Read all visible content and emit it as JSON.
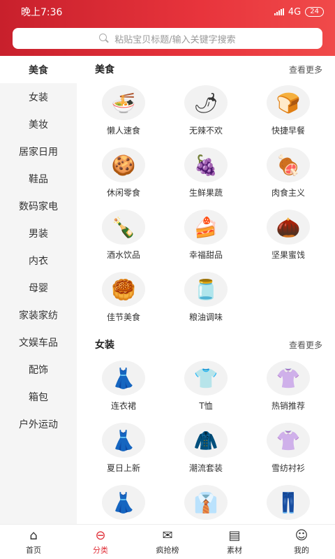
{
  "status": {
    "time": "晚上7:36",
    "network": "4G",
    "battery": "24"
  },
  "search": {
    "placeholder": "粘贴宝贝标题/输入关键字搜索"
  },
  "sidebar": {
    "items": [
      "美食",
      "女装",
      "美妆",
      "居家日用",
      "鞋品",
      "数码家电",
      "男装",
      "内衣",
      "母婴",
      "家装家纺",
      "文娱车品",
      "配饰",
      "箱包",
      "户外运动"
    ]
  },
  "sections": [
    {
      "title": "美食",
      "more": "查看更多",
      "items": [
        {
          "label": "懒人速食",
          "icon": "🍜"
        },
        {
          "label": "无辣不欢",
          "icon": "🌶"
        },
        {
          "label": "快捷早餐",
          "icon": "🍞"
        },
        {
          "label": "休闲零食",
          "icon": "🍪"
        },
        {
          "label": "生鲜果蔬",
          "icon": "🍇"
        },
        {
          "label": "肉食主义",
          "icon": "🍖"
        },
        {
          "label": "酒水饮品",
          "icon": "🍾"
        },
        {
          "label": "幸福甜品",
          "icon": "🍰"
        },
        {
          "label": "坚果蜜饯",
          "icon": "🌰"
        },
        {
          "label": "佳节美食",
          "icon": "🥮"
        },
        {
          "label": "粮油调味",
          "icon": "🫙"
        }
      ]
    },
    {
      "title": "女装",
      "more": "查看更多",
      "items": [
        {
          "label": "连衣裙",
          "icon": "👗"
        },
        {
          "label": "T恤",
          "icon": "👕"
        },
        {
          "label": "热销推荐",
          "icon": "👚"
        },
        {
          "label": "夏日上新",
          "icon": "👗"
        },
        {
          "label": "潮流套装",
          "icon": "🧥"
        },
        {
          "label": "雪纺衬衫",
          "icon": "👚"
        },
        {
          "label": "",
          "icon": "👗"
        },
        {
          "label": "",
          "icon": "👔"
        },
        {
          "label": "",
          "icon": "👖"
        }
      ]
    }
  ],
  "nav": [
    {
      "label": "首页",
      "icon": "⌂"
    },
    {
      "label": "分类",
      "icon": "⊖"
    },
    {
      "label": "疯抢榜",
      "icon": "✉"
    },
    {
      "label": "素材",
      "icon": "▤"
    },
    {
      "label": "我的",
      "icon": "☺"
    }
  ],
  "colors": {
    "brand": "#e0313a"
  }
}
